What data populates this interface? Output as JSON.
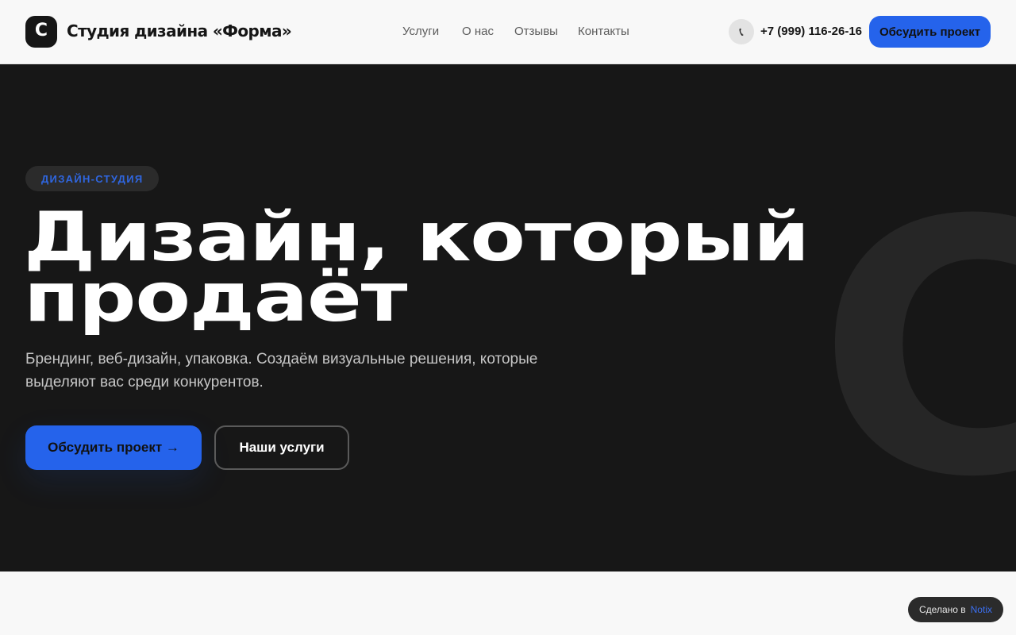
{
  "header": {
    "logo_glyph": "С",
    "brand_name": "Студия дизайна «Форма»",
    "nav": [
      {
        "label": "Услуги"
      },
      {
        "label": "О нас"
      },
      {
        "label": "Отзывы"
      },
      {
        "label": "Контакты"
      }
    ],
    "phone_icon": "phone-icon",
    "phone": "+7 (999) 116-26-16",
    "cta_label": "Обсудить проект"
  },
  "hero": {
    "badge": "ДИЗАЙН-СТУДИЯ",
    "headline_line1": "Дизайн, который",
    "headline_line2": "продаёт",
    "subtitle": "Брендинг, веб-дизайн, упаковка. Создаём визуальные решения, которые выделяют вас среди конкурентов.",
    "primary_button": "Обсудить проект →",
    "secondary_button": "Наши услуги",
    "background_glyph": "С"
  },
  "footer_badge": {
    "prefix": "Сделано в",
    "brand": "Notix"
  },
  "colors": {
    "accent": "#2563eb",
    "hero_background": "#171717",
    "page_background": "#f8f8f8",
    "text_dark": "#161616"
  }
}
